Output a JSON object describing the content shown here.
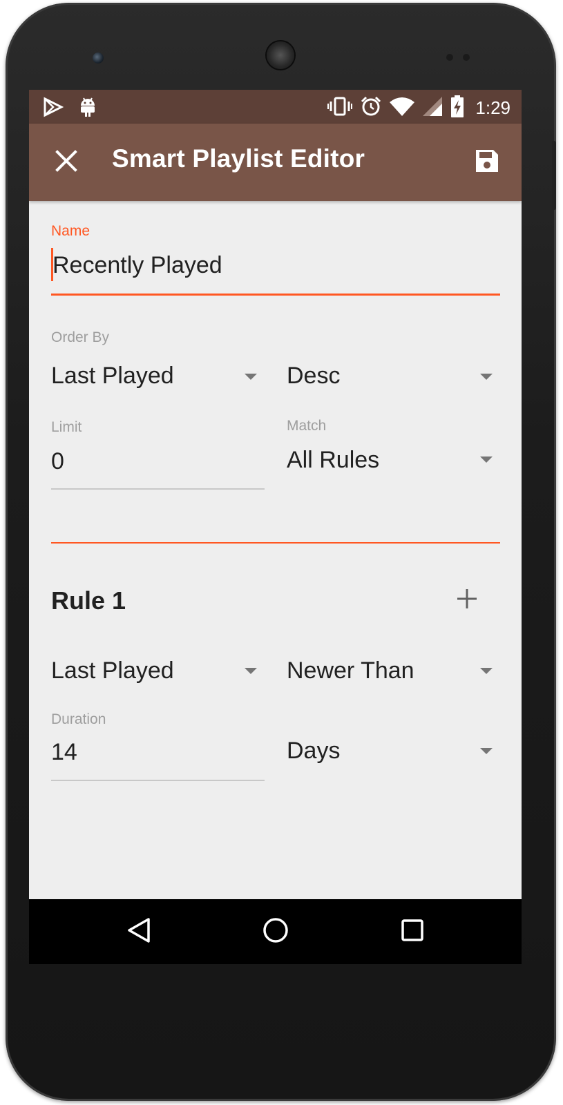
{
  "status_bar": {
    "time": "1:29",
    "left_icons": [
      "play-store-icon",
      "android-icon"
    ],
    "right_icons": [
      "vibrate-icon",
      "alarm-icon",
      "wifi-icon",
      "cell-signal-icon",
      "battery-charging-icon"
    ]
  },
  "app_bar": {
    "title": "Smart Playlist Editor",
    "close_icon": "close-icon",
    "save_icon": "save-icon"
  },
  "form": {
    "name": {
      "label": "Name",
      "value": "Recently Played"
    },
    "order_by": {
      "label": "Order By",
      "field": "Last Played",
      "direction": "Desc"
    },
    "limit": {
      "label": "Limit",
      "value": "0"
    },
    "match": {
      "label": "Match",
      "value": "All Rules"
    }
  },
  "rules": [
    {
      "title": "Rule 1",
      "field": "Last Played",
      "operator": "Newer Than",
      "duration_label": "Duration",
      "duration_value": "14",
      "unit": "Days"
    }
  ],
  "nav_bar": {
    "icons": [
      "back-icon",
      "home-icon",
      "recents-icon"
    ]
  },
  "colors": {
    "status_bar": "#5d4037",
    "app_bar": "#795548",
    "accent": "#ff5722",
    "background": "#eeeeee"
  }
}
